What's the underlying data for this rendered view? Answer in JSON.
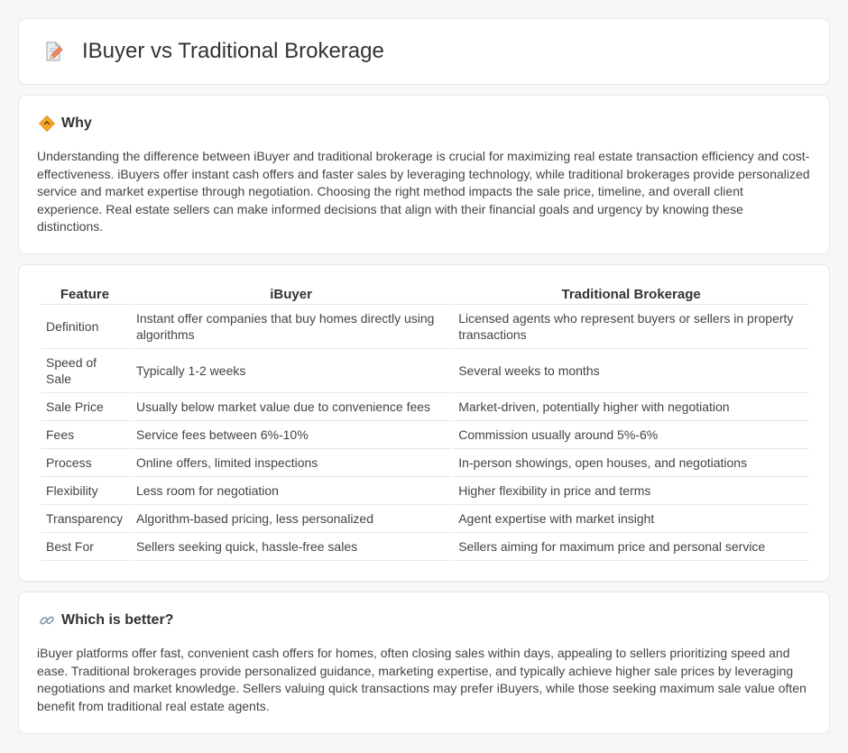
{
  "header": {
    "title": "IBuyer vs Traditional Brokerage",
    "icon": "document-pencil-icon"
  },
  "why": {
    "icon": "diamond-sign-icon",
    "title": "Why",
    "body": "Understanding the difference between iBuyer and traditional brokerage is crucial for maximizing real estate transaction efficiency and cost-effectiveness. iBuyers offer instant cash offers and faster sales by leveraging technology, while traditional brokerages provide personalized service and market expertise through negotiation. Choosing the right method impacts the sale price, timeline, and overall client experience. Real estate sellers can make informed decisions that align with their financial goals and urgency by knowing these distinctions."
  },
  "comparison": {
    "headers": [
      "Feature",
      "iBuyer",
      "Traditional Brokerage"
    ],
    "rows": [
      [
        "Definition",
        "Instant offer companies that buy homes directly using algorithms",
        "Licensed agents who represent buyers or sellers in property transactions"
      ],
      [
        "Speed of Sale",
        "Typically 1-2 weeks",
        "Several weeks to months"
      ],
      [
        "Sale Price",
        "Usually below market value due to convenience fees",
        "Market-driven, potentially higher with negotiation"
      ],
      [
        "Fees",
        "Service fees between 6%-10%",
        "Commission usually around 5%-6%"
      ],
      [
        "Process",
        "Online offers, limited inspections",
        "In-person showings, open houses, and negotiations"
      ],
      [
        "Flexibility",
        "Less room for negotiation",
        "Higher flexibility in price and terms"
      ],
      [
        "Transparency",
        "Algorithm-based pricing, less personalized",
        "Agent expertise with market insight"
      ],
      [
        "Best For",
        "Sellers seeking quick, hassle-free sales",
        "Sellers aiming for maximum price and personal service"
      ]
    ]
  },
  "better": {
    "icon": "link-icon",
    "title": "Which is better?",
    "body": "iBuyer platforms offer fast, convenient cash offers for homes, often closing sales within days, appealing to sellers prioritizing speed and ease. Traditional brokerages provide personalized guidance, marketing expertise, and typically achieve higher sale prices by leveraging negotiations and market knowledge. Sellers valuing quick transactions may prefer iBuyers, while those seeking maximum sale value often benefit from traditional real estate agents."
  }
}
